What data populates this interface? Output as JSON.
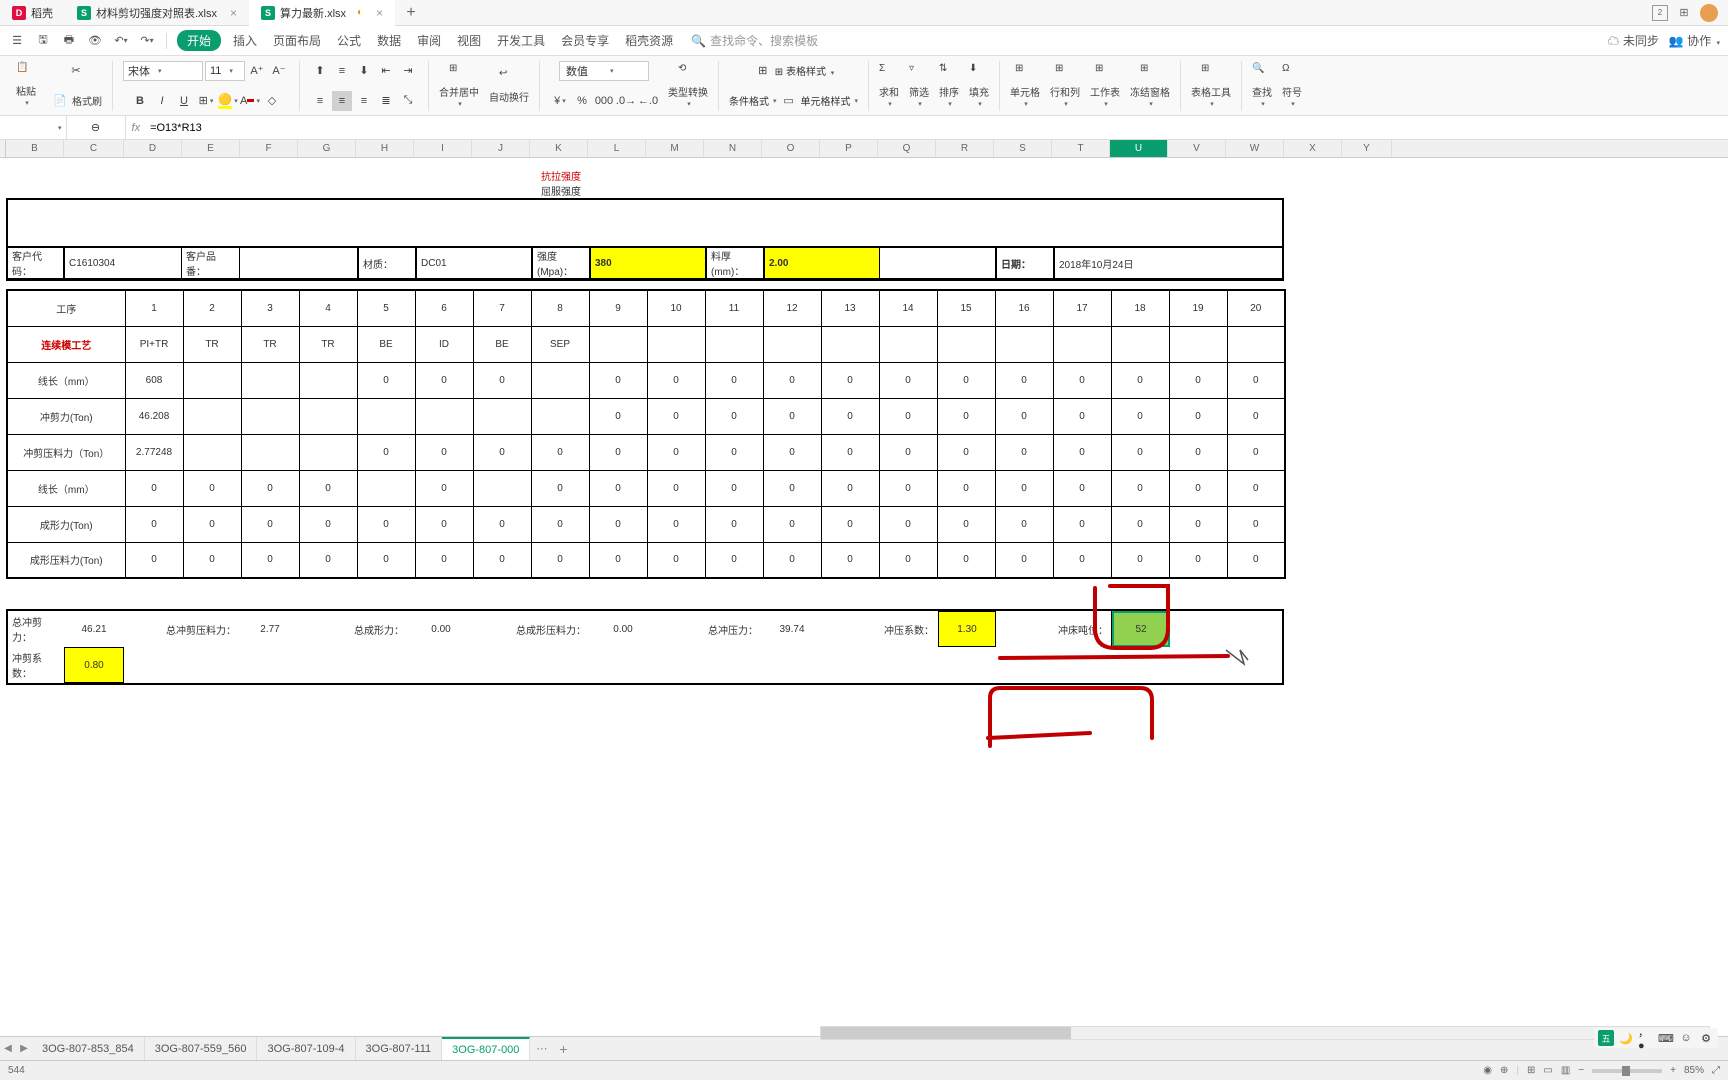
{
  "tabs": {
    "t1": {
      "name": "稻壳"
    },
    "t2": {
      "name": "材料剪切强度对照表.xlsx"
    },
    "t3": {
      "name": "算力最新.xlsx"
    }
  },
  "menu": {
    "start": "开始",
    "insert": "插入",
    "layout": "页面布局",
    "formula": "公式",
    "data": "数据",
    "review": "审阅",
    "view": "视图",
    "dev": "开发工具",
    "member": "会员专享",
    "resource": "稻壳资源",
    "search_ph": "查找命令、搜索模板"
  },
  "topright": {
    "sync": "未同步",
    "collab": "协作"
  },
  "ribbon": {
    "paste": "粘贴",
    "brush": "格式刷",
    "font_family": "宋体",
    "font_size": "11",
    "merge": "合并居中",
    "wrap": "自动换行",
    "numfmt": "数值",
    "convert": "类型转换",
    "rotate": "行和列",
    "cond": "条件格式",
    "cellstyle": "单元格样式",
    "sum": "求和",
    "filter": "筛选",
    "sort": "排序",
    "fill": "填充",
    "cell": "单元格",
    "rowcol": "行和列",
    "sheet": "工作表",
    "freeze": "冻结窗格",
    "tabletools": "表格工具",
    "find": "查找",
    "symbol": "符号"
  },
  "formula_bar": {
    "cell_ref": "",
    "formula": "=O13*R13"
  },
  "cols": [
    "B",
    "C",
    "D",
    "E",
    "F",
    "G",
    "H",
    "I",
    "J",
    "K",
    "L",
    "M",
    "N",
    "O",
    "P",
    "Q",
    "R",
    "S",
    "T",
    "U",
    "V",
    "W",
    "X",
    "Y"
  ],
  "hdr": {
    "tensile": "抗拉强度",
    "yield": "屈服强度"
  },
  "fields": {
    "cust_code_lbl": "客户代码：",
    "cust_code": "C1610304",
    "cust_prod_lbl": "客户品番：",
    "material_lbl": "材质：",
    "material": "DC01",
    "strength_lbl": "强度(Mpa)：",
    "strength": "380",
    "thickness_lbl": "料厚(mm)：",
    "thickness": "2.00",
    "date_lbl": "日期：",
    "date": "2018年10月24日"
  },
  "row_labels": {
    "process": "工序",
    "continuous": "连续模工艺",
    "line1": "线长（mm）",
    "shear": "冲剪力(Ton)",
    "shear_press": "冲剪压料力（Ton）",
    "line2": "线长（mm）",
    "form": "成形力(Ton)",
    "form_press": "成形压料力(Ton)"
  },
  "chart_data": {
    "type": "table",
    "process_nums": [
      "1",
      "2",
      "3",
      "4",
      "5",
      "6",
      "7",
      "8",
      "9",
      "10",
      "11",
      "12",
      "13",
      "14",
      "15",
      "16",
      "17",
      "18",
      "19",
      "20"
    ],
    "steps": [
      "PI+TR",
      "TR",
      "TR",
      "TR",
      "BE",
      "ID",
      "BE",
      "SEP",
      "",
      "",
      "",
      "",
      "",
      "",
      "",
      "",
      "",
      "",
      "",
      ""
    ],
    "line1": [
      "608",
      "",
      "",
      "",
      "0",
      "0",
      "0",
      "",
      "0",
      "0",
      "0",
      "0",
      "0",
      "0",
      "0",
      "0",
      "0",
      "0",
      "0",
      "0"
    ],
    "shear": [
      "46.208",
      "",
      "",
      "",
      "",
      "",
      "",
      "",
      "0",
      "0",
      "0",
      "0",
      "0",
      "0",
      "0",
      "0",
      "0",
      "0",
      "0",
      "0"
    ],
    "shear_press": [
      "2.77248",
      "",
      "",
      "",
      "0",
      "0",
      "0",
      "0",
      "0",
      "0",
      "0",
      "0",
      "0",
      "0",
      "0",
      "0",
      "0",
      "0",
      "0",
      "0"
    ],
    "line2": [
      "0",
      "0",
      "0",
      "0",
      "",
      "0",
      "",
      "0",
      "0",
      "0",
      "0",
      "0",
      "0",
      "0",
      "0",
      "0",
      "0",
      "0",
      "0",
      "0"
    ],
    "form": [
      "0",
      "0",
      "0",
      "0",
      "0",
      "0",
      "0",
      "0",
      "0",
      "0",
      "0",
      "0",
      "0",
      "0",
      "0",
      "0",
      "0",
      "0",
      "0",
      "0"
    ],
    "form_press": [
      "0",
      "0",
      "0",
      "0",
      "0",
      "0",
      "0",
      "0",
      "0",
      "0",
      "0",
      "0",
      "0",
      "0",
      "0",
      "0",
      "0",
      "0",
      "0",
      "0"
    ]
  },
  "totals": {
    "total_shear_lbl": "总冲剪力：",
    "total_shear": "46.21",
    "total_shear_press_lbl": "总冲剪压料力：",
    "total_shear_press": "2.77",
    "total_form_lbl": "总成形力：",
    "total_form": "0.00",
    "total_form_press_lbl": "总成形压料力：",
    "total_form_press": "0.00",
    "total_press_lbl": "总冲压力：",
    "total_press": "39.74",
    "press_coef_lbl": "冲压系数：",
    "press_coef": "1.30",
    "press_ton_lbl": "冲床吨位：",
    "press_ton": "52",
    "shear_coef_lbl": "冲剪系数：",
    "shear_coef": "0.80"
  },
  "sheets": {
    "s1": "3OG-807-853_854",
    "s2": "3OG-807-559_560",
    "s3": "3OG-807-109-4",
    "s4": "3OG-807-111",
    "s5": "3OG-807-000"
  },
  "status": {
    "left": "544",
    "zoom": "85%"
  },
  "ime": {
    "brand": "五"
  }
}
